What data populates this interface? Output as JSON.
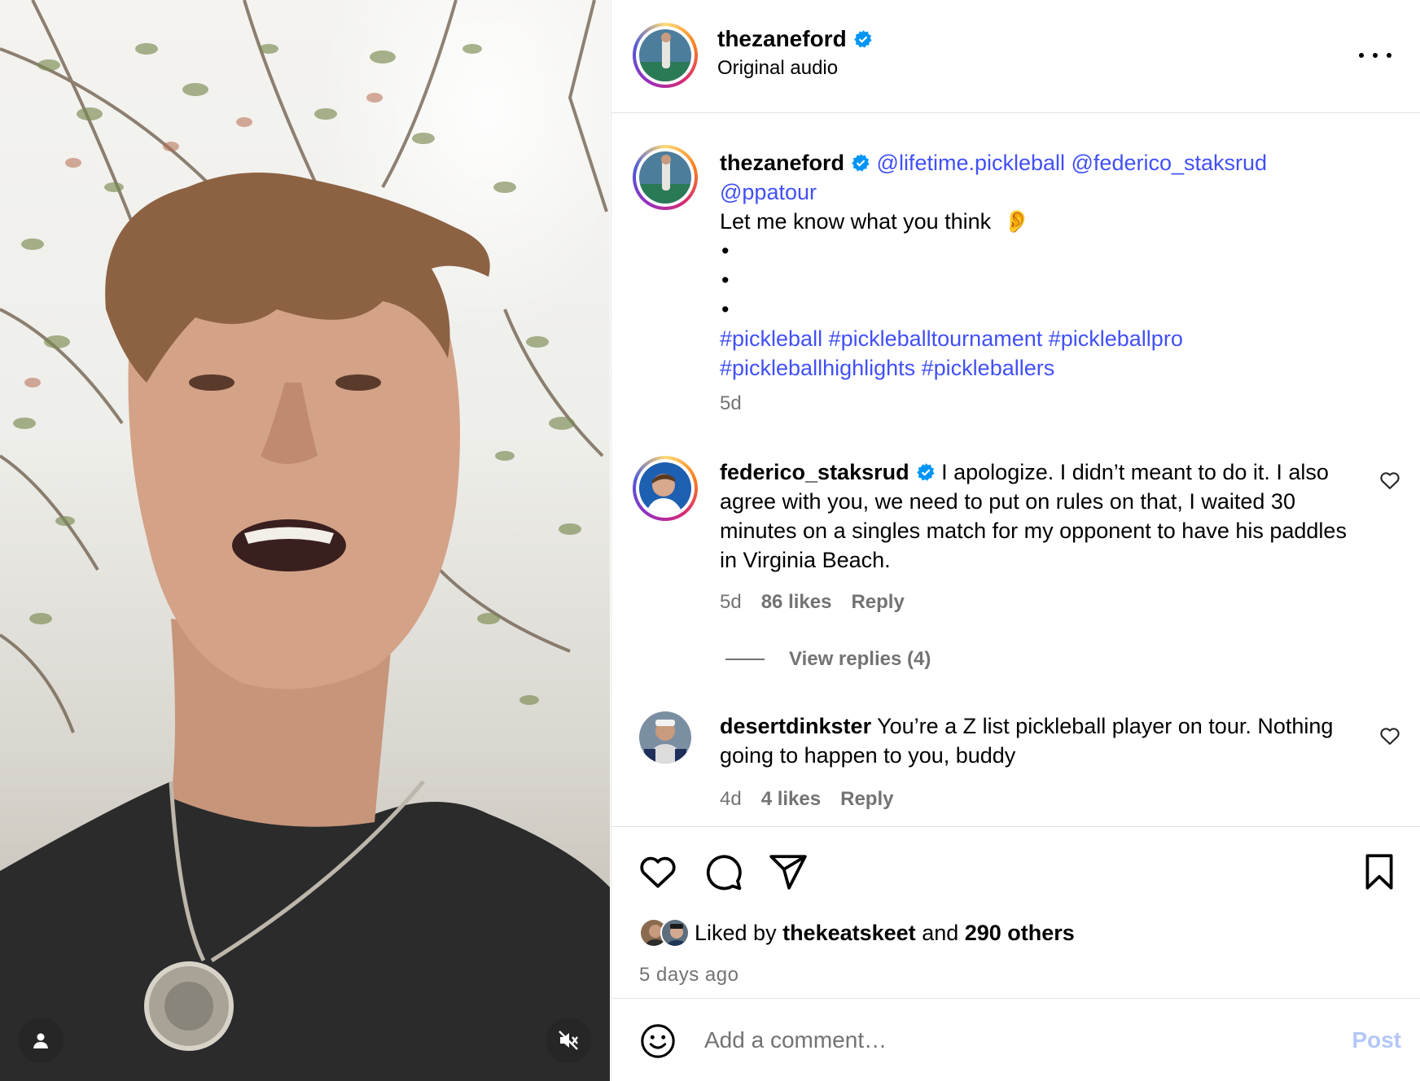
{
  "post": {
    "author": "thezaneford",
    "audio": "Original audio"
  },
  "caption": {
    "username": "thezaneford",
    "mentions_line1": "@lifetime.pickleball @federico_staksrud",
    "mentions_line2": "@ppatour",
    "text": "Let me know what you think",
    "emoji": "👂",
    "dot": "•",
    "hashtags_line1": "#pickleball #pickleballtournament #pickleballpro",
    "hashtags_line2": "#pickleballhighlights #pickleballers",
    "age": "5d"
  },
  "comments": [
    {
      "username": "federico_staksrud",
      "verified": true,
      "text": "I apologize. I didn’t meant to do it. I also agree with you, we need to put on rules on that, I waited 30 minutes on a singles match for my opponent to have his paddles in Virginia Beach.",
      "age": "5d",
      "likes": "86 likes",
      "reply": "Reply",
      "view_replies": "View replies (4)"
    },
    {
      "username": "desertdinkster",
      "verified": false,
      "text": "You’re a Z list pickleball player on tour. Nothing going to happen to you, buddy",
      "age": "4d",
      "likes": "4 likes",
      "reply": "Reply"
    }
  ],
  "likes": {
    "prefix": "Liked by ",
    "user": "thekeatskeet",
    "middle": " and ",
    "others": "290 others",
    "time": "5 days ago"
  },
  "add_comment": {
    "placeholder": "Add a comment…",
    "post_label": "Post"
  },
  "colors": {
    "link": "#4150f7",
    "verified": "#0095f6",
    "post_disabled": "#b3c7f7"
  },
  "icons": [
    "user-icon",
    "mute-icon",
    "more-icon",
    "verified-icon",
    "heart-icon",
    "comment-icon",
    "share-icon",
    "bookmark-icon",
    "emoji-icon"
  ]
}
